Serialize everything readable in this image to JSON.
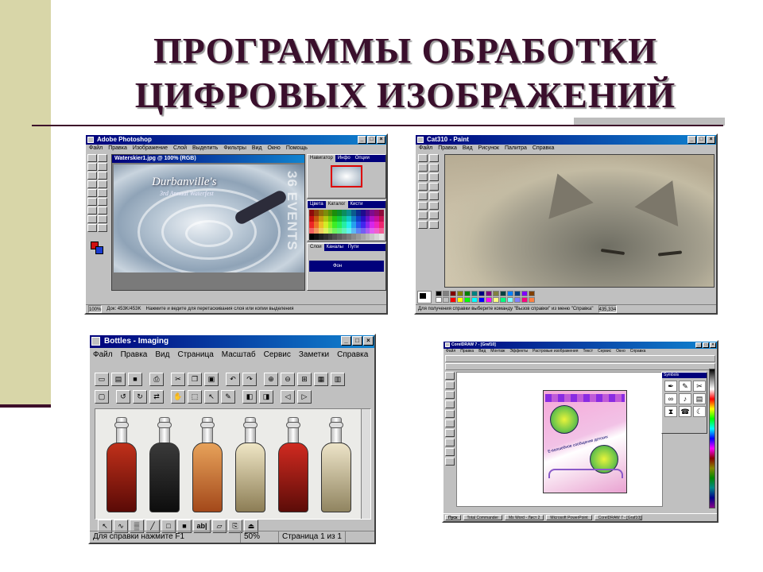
{
  "slide": {
    "title_line1": "ПРОГРАММЫ ОБРАБОТКИ",
    "title_line2": "ЦИФРОВЫХ ИЗОБРАЖЕНИЙ",
    "accent_color": "#3a0f2c",
    "band_color": "#d8d6a8"
  },
  "photoshop": {
    "window_title": "Adobe Photoshop",
    "menu": [
      "Файл",
      "Правка",
      "Изображение",
      "Слой",
      "Выделить",
      "Фильтры",
      "Вид",
      "Окно",
      "Помощь"
    ],
    "doc_title": "Waterskier1.jpg @ 100% (RGB)",
    "canvas_text": "Durbanville's",
    "canvas_subtext": "3rd Annual Waterfest",
    "canvas_vertical": "36 EVENTS",
    "panels": {
      "navigator_tabs": [
        "Навигатор",
        "Инфо",
        "Опции"
      ],
      "swatch_tabs": [
        "Цвета",
        "Каталог",
        "Кисти"
      ],
      "layers_tabs": [
        "Слои",
        "Каналы",
        "Пути"
      ],
      "layer_name": "Фон"
    },
    "status_zoom": "100%",
    "status_doc": "Док: 453K/453K",
    "status_hint": "Нажмите и ведите для перетаскивания слоя или копии выделения"
  },
  "paint": {
    "window_title": "Cat310 - Paint",
    "menu": [
      "Файл",
      "Правка",
      "Вид",
      "Рисунок",
      "Палитра",
      "Справка"
    ],
    "status_hint": "Для получения справки выберите команду \"Вызов справки\" из меню \"Справка\"",
    "status_coords": "435,334"
  },
  "imaging": {
    "window_title": "Bottles - Imaging",
    "menu": [
      "Файл",
      "Правка",
      "Вид",
      "Страница",
      "Масштаб",
      "Сервис",
      "Заметки",
      "Справка"
    ],
    "status_hint": "Для справки нажмите F1",
    "status_zoom": "50%",
    "status_page": "Страница 1 из 1",
    "bottom_text_tool": "ab|"
  },
  "coreldraw": {
    "window_title": "CorelDRAW 7 - [Graf10]",
    "menu": [
      "Файл",
      "Правка",
      "Вид",
      "Монтаж",
      "Эффекты",
      "Растровые изображения",
      "Текст",
      "Сервис",
      "Окно",
      "Справка"
    ],
    "docker_title": "Symbols",
    "page_caption": "Е-волшебное сообщение детских",
    "taskbar": {
      "start": "Пуск",
      "tasks": [
        "Total Commander",
        "Ms Word - Лист 2",
        "Microsoft PowerPoint",
        "CorelDRAW 7 - [Graf10]"
      ]
    }
  }
}
